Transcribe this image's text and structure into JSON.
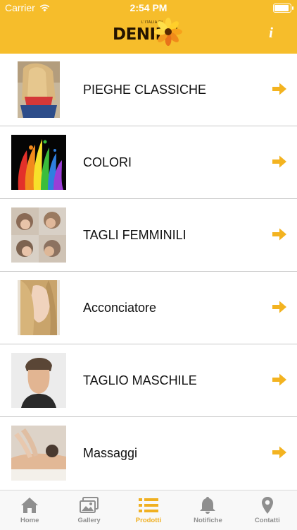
{
  "status_bar": {
    "carrier": "Carrier",
    "time": "2:54 PM",
    "battery_level": 1.0
  },
  "header": {
    "brand_small": "L'ITALIA DI",
    "brand": "DENIRE",
    "info_label": "i",
    "color": "#f6bd2b"
  },
  "colors": {
    "accent": "#f0b021",
    "arrow": "#f3b320",
    "tab_inactive": "#8f8f8f"
  },
  "list": {
    "items": [
      {
        "label": "PIEGHE CLASSICHE",
        "icon": "arrow-right-icon"
      },
      {
        "label": "COLORI",
        "icon": "arrow-right-icon"
      },
      {
        "label": "TAGLI FEMMINILI",
        "icon": "arrow-right-icon"
      },
      {
        "label": "Acconciatore",
        "icon": "arrow-right-icon"
      },
      {
        "label": "TAGLIO MASCHILE",
        "icon": "arrow-right-icon"
      },
      {
        "label": "Massaggi",
        "icon": "arrow-right-icon"
      }
    ]
  },
  "tabbar": {
    "tabs": [
      {
        "label": "Home",
        "icon": "home-icon"
      },
      {
        "label": "Gallery",
        "icon": "gallery-icon"
      },
      {
        "label": "Prodotti",
        "icon": "list-icon",
        "active": true
      },
      {
        "label": "Notifiche",
        "icon": "bell-icon"
      },
      {
        "label": "Contatti",
        "icon": "map-pin-icon"
      }
    ]
  }
}
